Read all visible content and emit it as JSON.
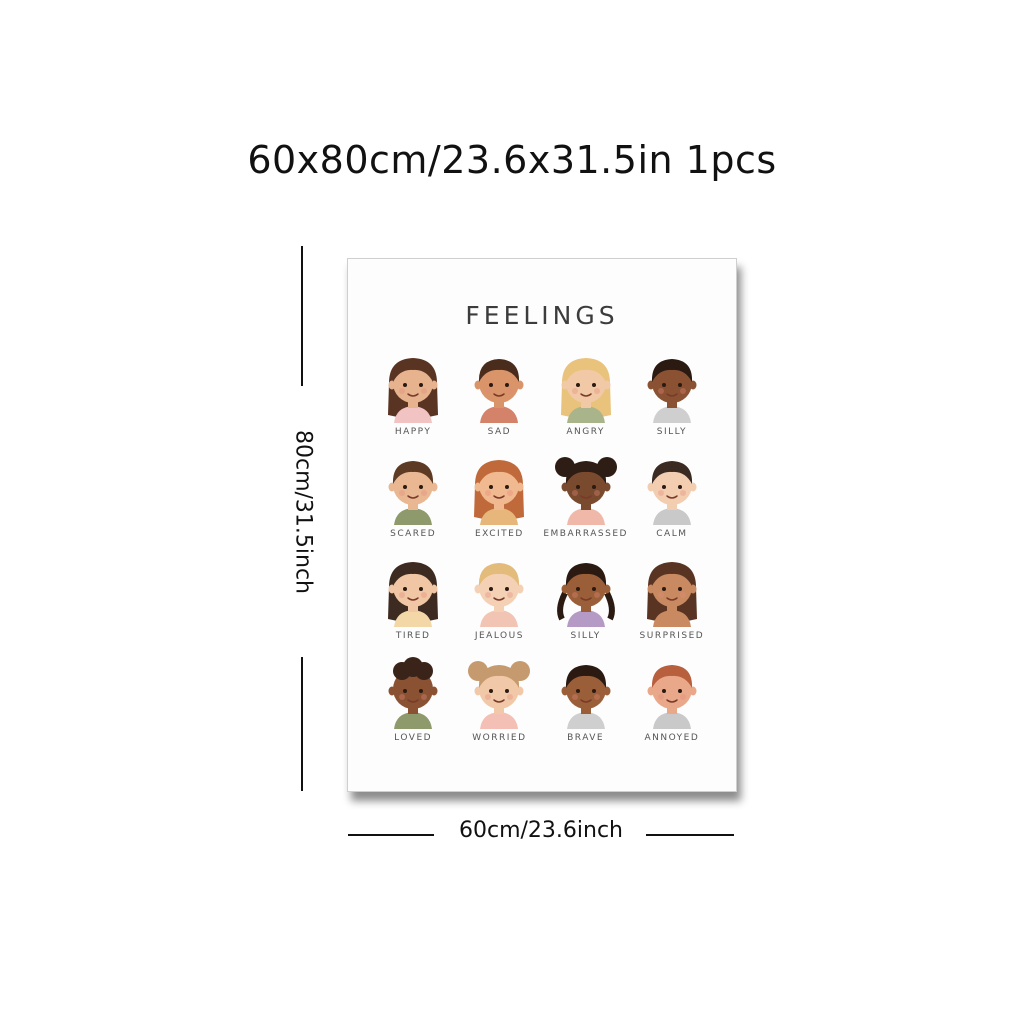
{
  "headline": "60x80cm/23.6x31.5in 1pcs",
  "poster": {
    "title": "FEELINGS",
    "faces": [
      {
        "label": "HAPPY",
        "skin": "#e7b38e",
        "hair": "#5a3422",
        "shirt": "#f1c3c3",
        "hair_style": "long"
      },
      {
        "label": "SAD",
        "skin": "#d9946a",
        "hair": "#4a2c1c",
        "shirt": "#d5826a",
        "hair_style": "short"
      },
      {
        "label": "ANGRY",
        "skin": "#f1c9a6",
        "hair": "#e9c37c",
        "shirt": "#aab48a",
        "hair_style": "long"
      },
      {
        "label": "SILLY",
        "skin": "#8a5233",
        "hair": "#2a1a12",
        "shirt": "#cfcfcf",
        "hair_style": "short"
      },
      {
        "label": "SCARED",
        "skin": "#e9b792",
        "hair": "#5d3a24",
        "shirt": "#8e9a6c",
        "hair_style": "short"
      },
      {
        "label": "EXCITED",
        "skin": "#f0b98f",
        "hair": "#c06a3c",
        "shirt": "#e6b67a",
        "hair_style": "long"
      },
      {
        "label": "EMBARRASSED",
        "skin": "#7a4a2e",
        "hair": "#2e1d14",
        "shirt": "#f0b8a8",
        "hair_style": "buns"
      },
      {
        "label": "CALM",
        "skin": "#f3cdb0",
        "hair": "#3a2a22",
        "shirt": "#c9c9c9",
        "hair_style": "short"
      },
      {
        "label": "TIRED",
        "skin": "#f0c6a4",
        "hair": "#3d2a20",
        "shirt": "#f3d7a6",
        "hair_style": "long"
      },
      {
        "label": "JEALOUS",
        "skin": "#f4d0b4",
        "hair": "#e3bb7a",
        "shirt": "#f1c4b4",
        "hair_style": "short"
      },
      {
        "label": "SILLY",
        "skin": "#9a5e38",
        "hair": "#2a1a12",
        "shirt": "#b49ac4",
        "hair_style": "pigtails"
      },
      {
        "label": "SURPRISED",
        "skin": "#c98a62",
        "hair": "#5a3422",
        "shirt": "#c98a62",
        "hair_style": "long"
      },
      {
        "label": "LOVED",
        "skin": "#8a5233",
        "hair": "#3a241a",
        "shirt": "#8e9a6c",
        "hair_style": "curly"
      },
      {
        "label": "WORRIED",
        "skin": "#f1c9a8",
        "hair": "#c59a6e",
        "shirt": "#f4c0b6",
        "hair_style": "buns"
      },
      {
        "label": "BRAVE",
        "skin": "#9a5e38",
        "hair": "#2a1a12",
        "shirt": "#cfcfcf",
        "hair_style": "short"
      },
      {
        "label": "ANNOYED",
        "skin": "#e9a889",
        "hair": "#b85f3e",
        "shirt": "#c9c9c9",
        "hair_style": "short"
      }
    ]
  },
  "dimensions": {
    "width_label": "60cm/23.6inch",
    "height_label": "80cm/31.5inch"
  }
}
